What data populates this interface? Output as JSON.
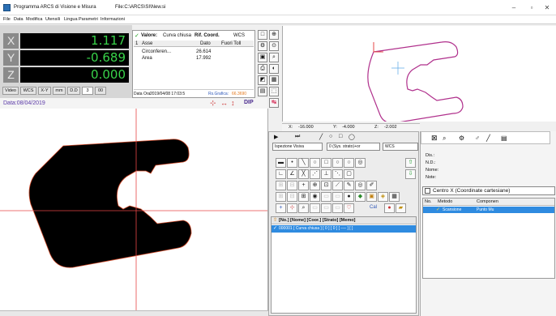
{
  "window": {
    "title": "Programma ARCS di Visione e Misura",
    "file": "File:C:\\ARCS\\SI\\New.si",
    "controls": [
      "–",
      "▫",
      "✕"
    ]
  },
  "menu": [
    "File",
    "Data",
    "Modifica",
    "Utensili",
    "Lingua",
    "Parametri",
    "Informazioni"
  ],
  "dro": {
    "x_label": "X",
    "x_value": "1.117",
    "y_label": "Y",
    "y_value": "-0.689",
    "z_label": "Z",
    "z_value": "0.000"
  },
  "dro_buttons": [
    "Video",
    "WCS",
    "X-Y",
    "mm",
    "D.D",
    "3",
    "00"
  ],
  "date_label": "Data:08/04/2019",
  "dip_label": "DIP",
  "values_panel": {
    "check": "✓",
    "label": "Valore:",
    "feature": "Curva chiusa",
    "ref": "Rif. Coord.",
    "wcs": "WCS",
    "columns": [
      "1",
      "Asse",
      "Dato",
      "Fuori Toll"
    ],
    "rows": [
      {
        "name": "Circonferen...",
        "value": "26.614"
      },
      {
        "name": "Area",
        "value": "17.992"
      }
    ],
    "footer_date_label": "Data Ora:",
    "footer_date": "2019/04/08 17:03:5",
    "footer_scale_label": "Rs.Grafica:",
    "footer_scale": "66.3690"
  },
  "coord_bar": {
    "x_label": "X:",
    "x": "-16.000",
    "y_label": "Y:",
    "y": "-4.000",
    "z_label": "Z:",
    "z": "-2.002"
  },
  "inspection": {
    "mode": "Ispezione Visiva",
    "system": "0 (Sys. strato)+or",
    "wcs": "WCS"
  },
  "toolbar_glyphs": [
    "▬",
    "•",
    "╲",
    "○",
    "□",
    "○",
    "○",
    "◎",
    "⇩",
    "⇧"
  ],
  "cal_label": "Cal",
  "table": {
    "headers": "[No.] [Nome] [Coor.] [Strato] [Memo]",
    "row": "000001 [ Curva chiusa ] [ 0 ] [ 0 ] [ ---- ] [ ]"
  },
  "right_panel": {
    "fields": [
      "Dis.:",
      "N.D.:",
      "Nome:",
      "Note:"
    ],
    "center_label": "Centro X (Coordinate cartesiane)",
    "list_headers": [
      "No.",
      "Metodo",
      "Componen"
    ],
    "list_row": {
      "method": "Scansione",
      "component": "Punto Mu"
    }
  },
  "colors": {
    "dro_green": "#39d34a",
    "selection_blue": "#2f8be0",
    "profile_magenta": "#b0308c",
    "crosshair_red": "#e64646"
  }
}
